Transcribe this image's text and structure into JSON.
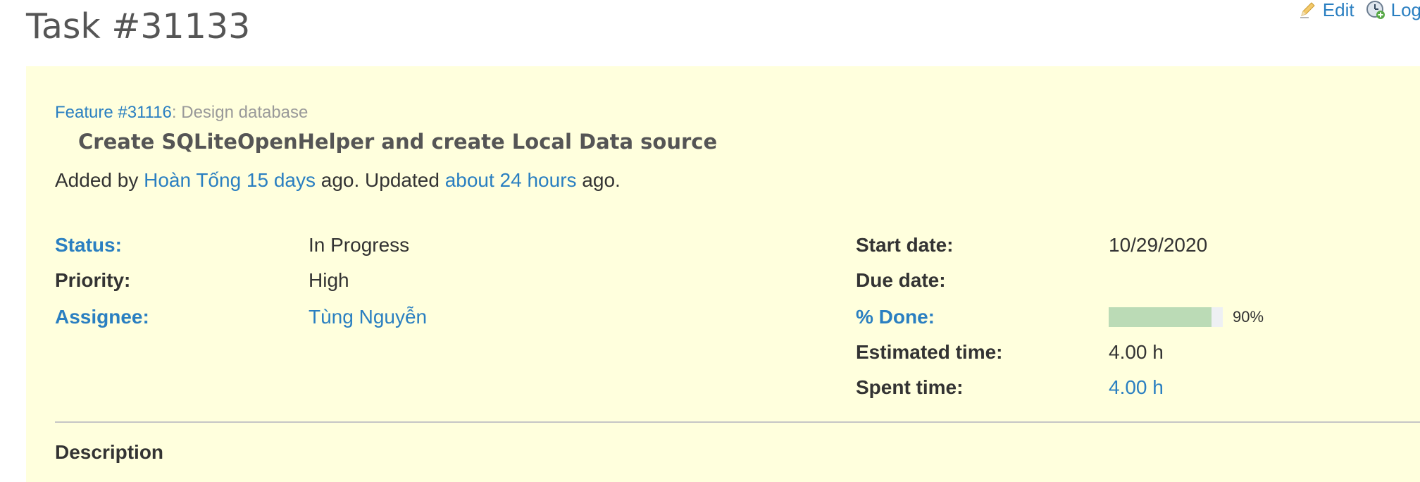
{
  "page": {
    "title": "Task #31133"
  },
  "toolbar": {
    "edit_label": "Edit",
    "log_label": "Log"
  },
  "issue": {
    "parent_link": "Feature #31116",
    "parent_separator": ":",
    "parent_title": "Design database",
    "subject": "Create SQLiteOpenHelper and create Local Data source",
    "author": {
      "prefix": "Added by",
      "name": "Hoàn Tống",
      "added_ago": "15 days",
      "middle": "ago. Updated",
      "updated_ago": "about 24 hours",
      "suffix": "ago."
    },
    "attributes_left": {
      "status_label": "Status:",
      "status_value": "In Progress",
      "priority_label": "Priority:",
      "priority_value": "High",
      "assignee_label": "Assignee:",
      "assignee_value": "Tùng Nguyễn"
    },
    "attributes_right": {
      "start_date_label": "Start date:",
      "start_date_value": "10/29/2020",
      "due_date_label": "Due date:",
      "due_date_value": "",
      "done_label": "% Done:",
      "done_percent": 90,
      "done_text": "90%",
      "estimated_label": "Estimated time:",
      "estimated_value": "4.00 h",
      "spent_label": "Spent time:",
      "spent_value": "4.00 h"
    },
    "description_heading": "Description"
  },
  "colors": {
    "link": "#2a7fc1",
    "issue_background": "#ffffdd",
    "progress_done": "#bbdbb6",
    "progress_track": "#eef0f3"
  },
  "icons": {
    "edit": "pencil-icon",
    "log": "clock-add-icon"
  }
}
